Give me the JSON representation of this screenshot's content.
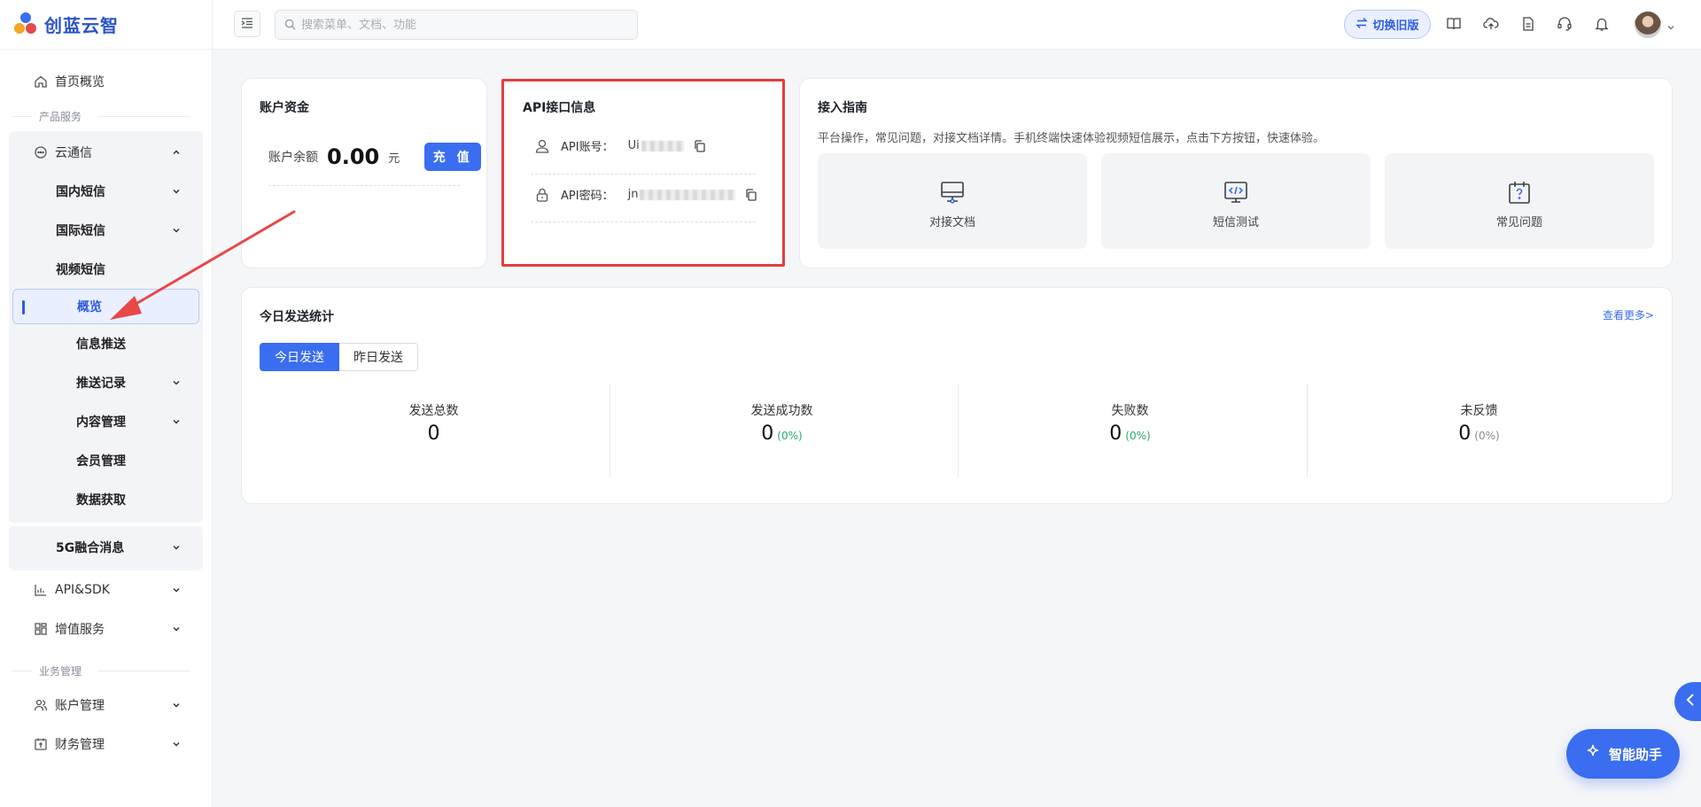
{
  "brand": {
    "name": "创蓝云智"
  },
  "sidebar": {
    "home": "首页概览",
    "group_product": "产品服务",
    "cloud_comm": "云通信",
    "domestic_sms": "国内短信",
    "intl_sms": "国际短信",
    "video_sms": "视频短信",
    "overview": "概览",
    "message_push": "信息推送",
    "push_records": "推送记录",
    "content_mgmt": "内容管理",
    "member_mgmt": "会员管理",
    "data_fetch": "数据获取",
    "fusion_5g": "5G融合消息",
    "api_sdk": "API&SDK",
    "value_added": "增值服务",
    "group_business": "业务管理",
    "account_mgmt": "账户管理",
    "finance_mgmt": "财务管理"
  },
  "topbar": {
    "search_placeholder": "搜索菜单、文档、功能",
    "switch_label": "切换旧版",
    "icons": [
      "book-icon",
      "cloud-upload-icon",
      "document-icon",
      "headset-icon",
      "bell-icon"
    ]
  },
  "account_card": {
    "title": "账户资金",
    "balance_label": "账户余额",
    "balance_value": "0.00",
    "balance_unit": "元",
    "recharge_label": "充 值"
  },
  "api_card": {
    "title": "API接口信息",
    "account_label": "API账号：",
    "account_value_prefix": "Ui",
    "password_label": "API密码：",
    "password_value_prefix": "jn"
  },
  "guide_card": {
    "title": "接入指南",
    "description": "平台操作，常见问题，对接文档详情。手机终端快速体验视频短信展示，点击下方按钮，快速体验。",
    "items": [
      {
        "label": "对接文档",
        "icon": "monitor-icon"
      },
      {
        "label": "短信测试",
        "icon": "code-screen-icon"
      },
      {
        "label": "常见问题",
        "icon": "calendar-question-icon"
      }
    ]
  },
  "stats_card": {
    "title": "今日发送统计",
    "more_link": "查看更多>",
    "tabs": [
      "今日发送",
      "昨日发送"
    ],
    "active_tab": 0,
    "stats": [
      {
        "label": "发送总数",
        "value": "0",
        "pct": ""
      },
      {
        "label": "发送成功数",
        "value": "0",
        "pct": "(0%)"
      },
      {
        "label": "失败数",
        "value": "0",
        "pct": "(0%)"
      },
      {
        "label": "未反馈",
        "value": "0",
        "pct": "(0%)"
      }
    ]
  },
  "assistant": {
    "label": "智能助手"
  },
  "colors": {
    "accent": "#3a6df0",
    "brand": "#2a55c8",
    "success_pct": "#2aa86a",
    "neutral_pct": "#888888",
    "annotation_red": "#e23d3d"
  }
}
